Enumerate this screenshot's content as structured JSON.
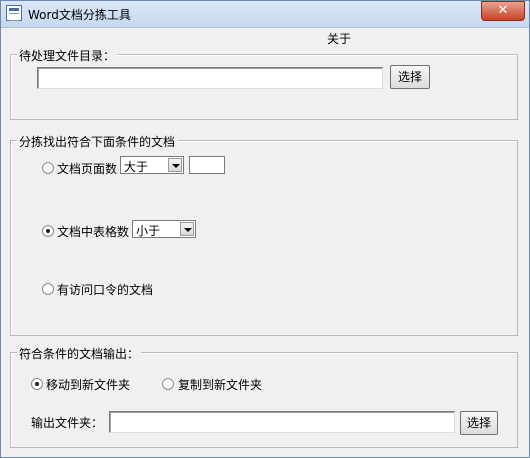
{
  "window": {
    "title": "Word文档分拣工具",
    "close_label": "✕"
  },
  "menu": {
    "about": "关于"
  },
  "dir_group": {
    "title": "待处理文件目录：",
    "input_value": "",
    "select_button": "选择"
  },
  "filter_group": {
    "title": "分拣找出符合下面条件的文档",
    "options": [
      {
        "label": "文档页面数",
        "checked": false,
        "operator": "大于",
        "value": ""
      },
      {
        "label": "文档中表格数",
        "checked": true,
        "operator": "小于"
      },
      {
        "label": "有访问口令的文档",
        "checked": false
      }
    ]
  },
  "output_group": {
    "title": "符合条件的文档输出：",
    "move_label": "移动到新文件夹",
    "move_checked": true,
    "copy_label": "复制到新文件夹",
    "copy_checked": false,
    "folder_label": "输出文件夹：",
    "folder_value": "",
    "select_button": "选择"
  }
}
